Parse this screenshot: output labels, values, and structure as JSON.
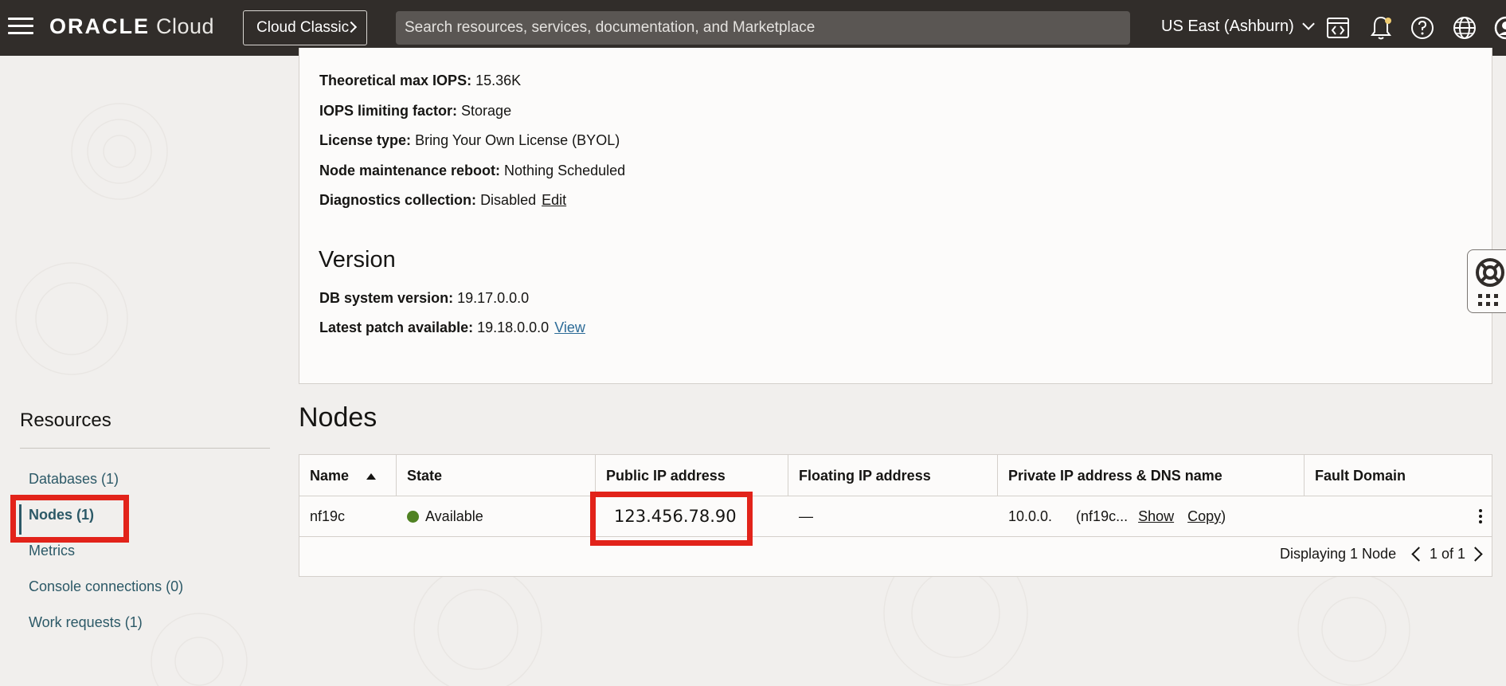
{
  "topbar": {
    "brand_oracle": "ORACLE",
    "brand_cloud": "Cloud",
    "classic_label": "Cloud Classic",
    "search_placeholder": "Search resources, services, documentation, and Marketplace",
    "region": "US East (Ashburn)",
    "icons": [
      "code-editor-icon",
      "bell-icon",
      "help-icon",
      "globe-icon",
      "profile-icon"
    ]
  },
  "details": {
    "max_iops_label": "Theoretical max IOPS:",
    "max_iops_value": "15.36K",
    "iops_limit_label": "IOPS limiting factor:",
    "iops_limit_value": "Storage",
    "license_label": "License type:",
    "license_value": "Bring Your Own License (BYOL)",
    "maint_label": "Node maintenance reboot:",
    "maint_value": "Nothing Scheduled",
    "diag_label": "Diagnostics collection:",
    "diag_value": "Disabled",
    "diag_link": "Edit"
  },
  "version": {
    "heading": "Version",
    "db_label": "DB system version:",
    "db_value": "19.17.0.0.0",
    "patch_label": "Latest patch available:",
    "patch_value": "19.18.0.0.0",
    "patch_link": "View"
  },
  "resources": {
    "title": "Resources",
    "items": [
      {
        "label": "Databases (1)"
      },
      {
        "label": "Nodes (1)",
        "active": true
      },
      {
        "label": "Metrics"
      },
      {
        "label": "Console connections (0)"
      },
      {
        "label": "Work requests (1)"
      }
    ]
  },
  "nodes": {
    "heading": "Nodes",
    "columns": [
      "Name",
      "State",
      "Public IP address",
      "Floating IP address",
      "Private IP address & DNS name",
      "Fault Domain"
    ],
    "row": {
      "name": "nf19c",
      "state": "Available",
      "public_ip": "123.456.78.90",
      "floating_ip": "—",
      "private_ip": "10.0.0.",
      "dns_prefix": "(nf19c...",
      "show": "Show",
      "copy": "Copy",
      "dns_suffix": ")"
    },
    "footer": {
      "displaying": "Displaying 1 Node",
      "page": "1 of 1"
    }
  },
  "colors": {
    "topbar": "#312d2a",
    "link": "#2c5967",
    "highlight": "#e2231a",
    "available": "#508223"
  }
}
